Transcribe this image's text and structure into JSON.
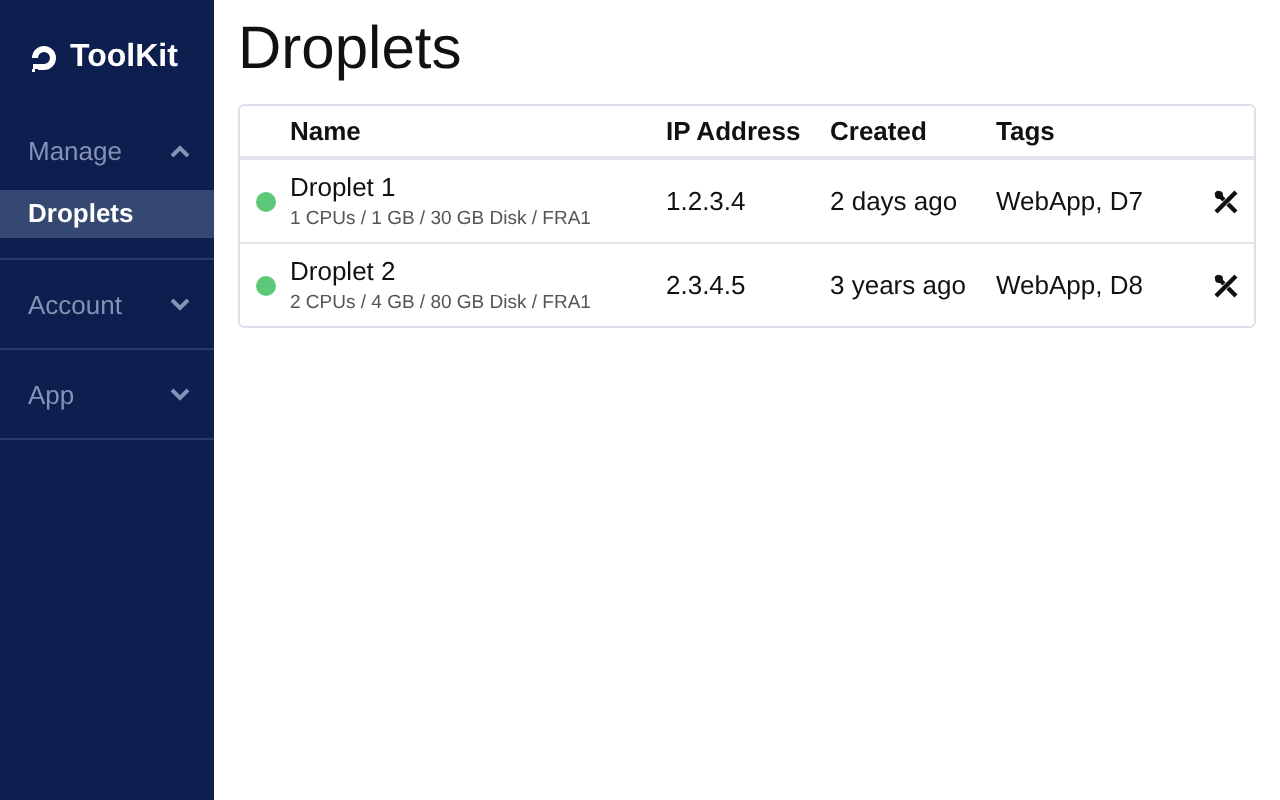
{
  "sidebar": {
    "logo": "ToolKit",
    "sections": [
      {
        "label": "Manage",
        "expanded": true,
        "items": [
          {
            "label": "Droplets",
            "selected": true
          }
        ]
      },
      {
        "label": "Account",
        "expanded": false
      },
      {
        "label": "App",
        "expanded": false
      }
    ]
  },
  "page": {
    "title": "Droplets"
  },
  "table": {
    "columns": [
      "Name",
      "IP Address",
      "Created",
      "Tags"
    ],
    "rows": [
      {
        "color": "#5dc878",
        "name": "Droplet 1",
        "specs": "1 CPUs / 1 GB / 30 GB Disk / FRA1",
        "ip": "1.2.3.4",
        "created": "2 days ago",
        "tags": "WebApp, D7"
      },
      {
        "color": "#5dc878",
        "name": "Droplet 2",
        "specs": "2 CPUs / 4 GB / 80 GB Disk / FRA1",
        "ip": "2.3.4.5",
        "created": "3 years ago",
        "tags": "WebApp, D8"
      }
    ]
  }
}
